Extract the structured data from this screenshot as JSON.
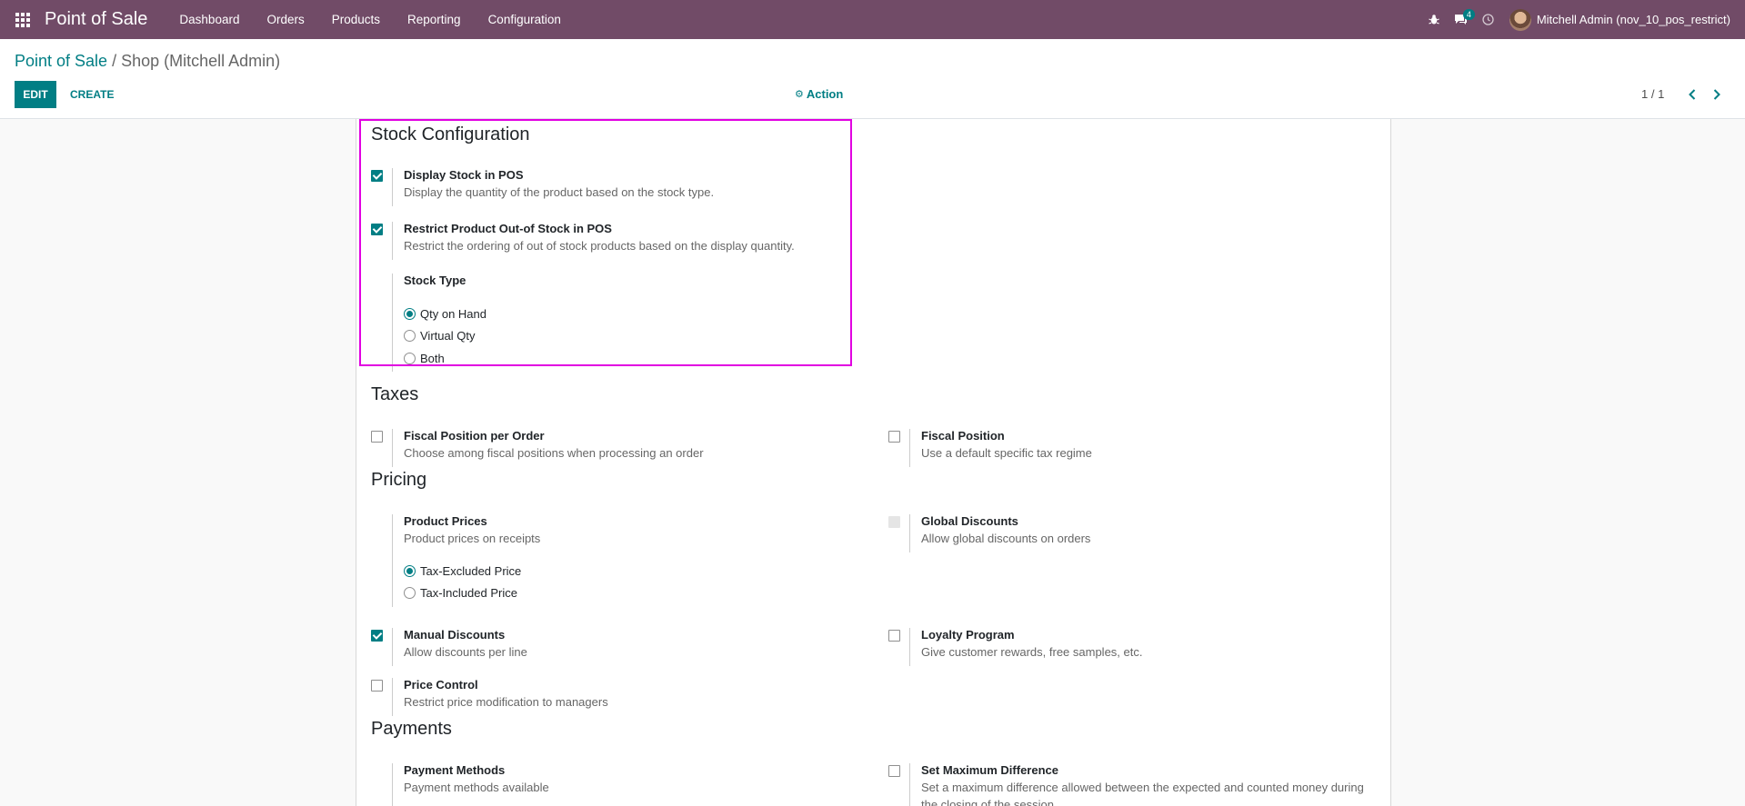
{
  "navbar": {
    "brand": "Point of Sale",
    "menu": [
      "Dashboard",
      "Orders",
      "Products",
      "Reporting",
      "Configuration"
    ],
    "message_count": "4",
    "user_name": "Mitchell Admin (nov_10_pos_restrict)",
    "accent": "#714b67"
  },
  "breadcrumb": {
    "root": "Point of Sale",
    "separator": "/",
    "current": "Shop (Mitchell Admin)"
  },
  "toolbar": {
    "edit_label": "EDIT",
    "create_label": "CREATE",
    "action_label": "Action",
    "pager": "1 / 1"
  },
  "sections": {
    "stock": {
      "title": "Stock Configuration",
      "display_stock": {
        "title": "Display Stock in POS",
        "desc": "Display the quantity of the product based on the stock type.",
        "checked": true
      },
      "restrict_stock": {
        "title": "Restrict Product Out-of Stock in POS",
        "desc": "Restrict the ordering of out of stock products based on the display quantity.",
        "checked": true
      },
      "stock_type": {
        "title": "Stock Type",
        "options": [
          "Qty on Hand",
          "Virtual Qty",
          "Both"
        ],
        "selected": "Qty on Hand"
      }
    },
    "taxes": {
      "title": "Taxes",
      "fiscal_per_order": {
        "title": "Fiscal Position per Order",
        "desc": "Choose among fiscal positions when processing an order",
        "checked": false
      },
      "fiscal_position": {
        "title": "Fiscal Position",
        "desc": "Use a default specific tax regime",
        "checked": false
      }
    },
    "pricing": {
      "title": "Pricing",
      "product_prices": {
        "title": "Product Prices",
        "desc": "Product prices on receipts",
        "options": [
          "Tax-Excluded Price",
          "Tax-Included Price"
        ],
        "selected": "Tax-Excluded Price"
      },
      "global_discounts": {
        "title": "Global Discounts",
        "desc": "Allow global discounts on orders",
        "disabled": true
      },
      "manual_discounts": {
        "title": "Manual Discounts",
        "desc": "Allow discounts per line",
        "checked": true
      },
      "loyalty": {
        "title": "Loyalty Program",
        "desc": "Give customer rewards, free samples, etc.",
        "checked": false
      },
      "price_control": {
        "title": "Price Control",
        "desc": "Restrict price modification to managers",
        "checked": false
      }
    },
    "payments": {
      "title": "Payments",
      "payment_methods": {
        "title": "Payment Methods",
        "desc": "Payment methods available"
      },
      "max_difference": {
        "title": "Set Maximum Difference",
        "desc": "Set a maximum difference allowed between the expected and counted money during",
        "desc2": "the closing of the session",
        "checked": false
      }
    }
  }
}
